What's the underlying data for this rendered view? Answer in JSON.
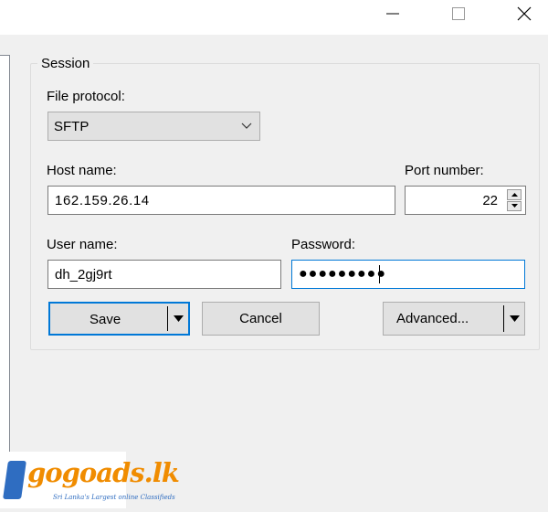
{
  "window": {
    "controls": {
      "minimize_icon": "minimize-icon",
      "maximize_icon": "maximize-icon",
      "close_icon": "close-icon"
    }
  },
  "session": {
    "group_title": "Session",
    "file_protocol_label": "File protocol:",
    "file_protocol_value": "SFTP",
    "host_label": "Host name:",
    "host_value": "162.159.26.14",
    "port_label": "Port number:",
    "port_value": "22",
    "user_label": "User name:",
    "user_value": "dh_2gj9rt",
    "password_label": "Password:",
    "password_mask": "●●●●●●●●●"
  },
  "buttons": {
    "save_label": "Save",
    "cancel_label": "Cancel",
    "advanced_label": "Advanced..."
  },
  "watermark": {
    "logo_text": "gogoads.lk",
    "tagline": "Sri Lanka's Largest online Classifieds",
    "brand_blue": "#2f6dc1",
    "brand_orange": "#f08c00"
  },
  "colors": {
    "accent": "#0078d7",
    "window_bg": "#f0f0f0",
    "button_bg": "#e1e1e1"
  }
}
